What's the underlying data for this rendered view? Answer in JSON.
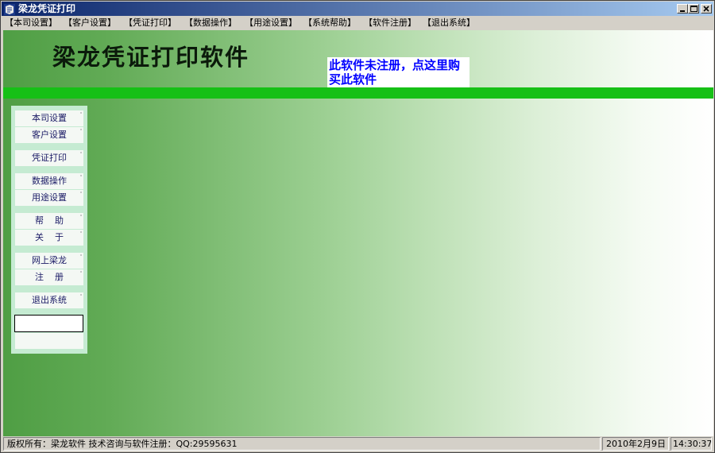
{
  "window": {
    "title": "梁龙凭证打印",
    "minimize_glyph": "minimize-icon",
    "maximize_glyph": "maximize-icon",
    "close_glyph": "close-icon"
  },
  "menu": [
    {
      "label": "【本司设置】"
    },
    {
      "label": "【客户设置】"
    },
    {
      "label": "【凭证打印】"
    },
    {
      "label": "【数据操作】"
    },
    {
      "label": "【用途设置】"
    },
    {
      "label": "【系统帮助】"
    },
    {
      "label": "【软件注册】"
    },
    {
      "label": "【退出系统】"
    }
  ],
  "header": {
    "app_title": "梁龙凭证打印软件",
    "register_notice": "此软件未注册，点这里购买此软件"
  },
  "sidebar": {
    "buttons": [
      {
        "label": "本司设置"
      },
      {
        "label": "客户设置"
      },
      {
        "label": "凭证打印"
      },
      {
        "label": "数据操作"
      },
      {
        "label": "用途设置"
      },
      {
        "label": "帮    助"
      },
      {
        "label": "关    于"
      },
      {
        "label": "网上梁龙"
      },
      {
        "label": "注    册"
      },
      {
        "label": "退出系统"
      }
    ],
    "input_value": ""
  },
  "status": {
    "copyright": "版权所有：梁龙软件  技术咨询与软件注册：QQ:29595631",
    "date": "2010年2月9日",
    "time": "14:30:37"
  },
  "colors": {
    "title_bar_start": "#0a246a",
    "title_bar_end": "#a6caf0",
    "band_green": "#16c016",
    "notice_blue": "#0000ff",
    "panel_green": "#c5ebd2"
  }
}
